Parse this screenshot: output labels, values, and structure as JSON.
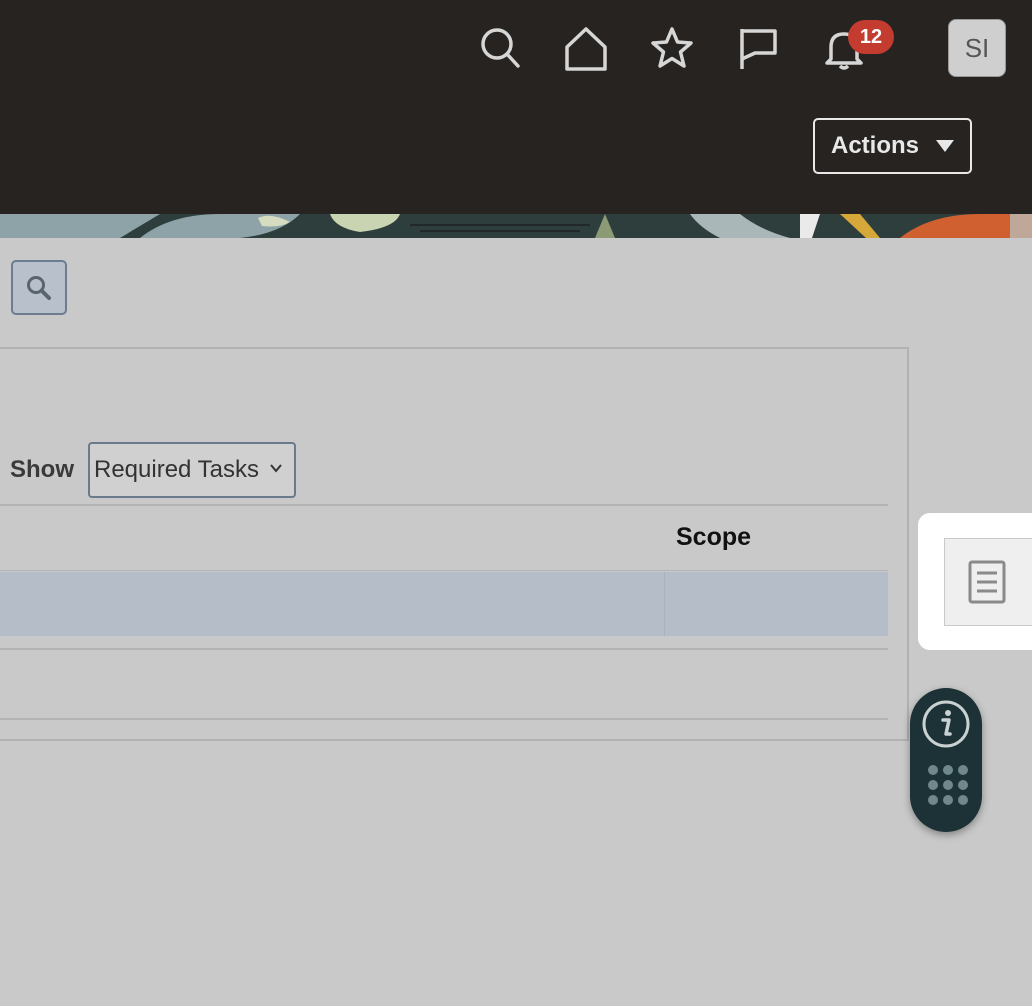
{
  "header": {
    "icons": [
      "search-icon",
      "home-icon",
      "favorites-star-icon",
      "flag-icon",
      "notifications-bell-icon"
    ],
    "notifications_count": "12",
    "user_initials": "SI",
    "actions_label": "Actions"
  },
  "toolbar": {
    "search_icon": "search-icon"
  },
  "table": {
    "show_label": "Show",
    "show_value": "Required Tasks",
    "columns": [
      "Scope"
    ],
    "rows": [
      {
        "scope": "",
        "selected": true
      },
      {
        "scope": "",
        "selected": false
      }
    ]
  },
  "side_panel": {
    "doc_icon": "document-icon",
    "info_icon": "info-icon",
    "apps_icon": "apps-grid-icon"
  },
  "colors": {
    "header_bg": "#262321",
    "page_bg": "#c9c9c9",
    "badge": "#c43b2f",
    "selected_row": "#b5bec8",
    "info_pill": "#1c3236"
  }
}
